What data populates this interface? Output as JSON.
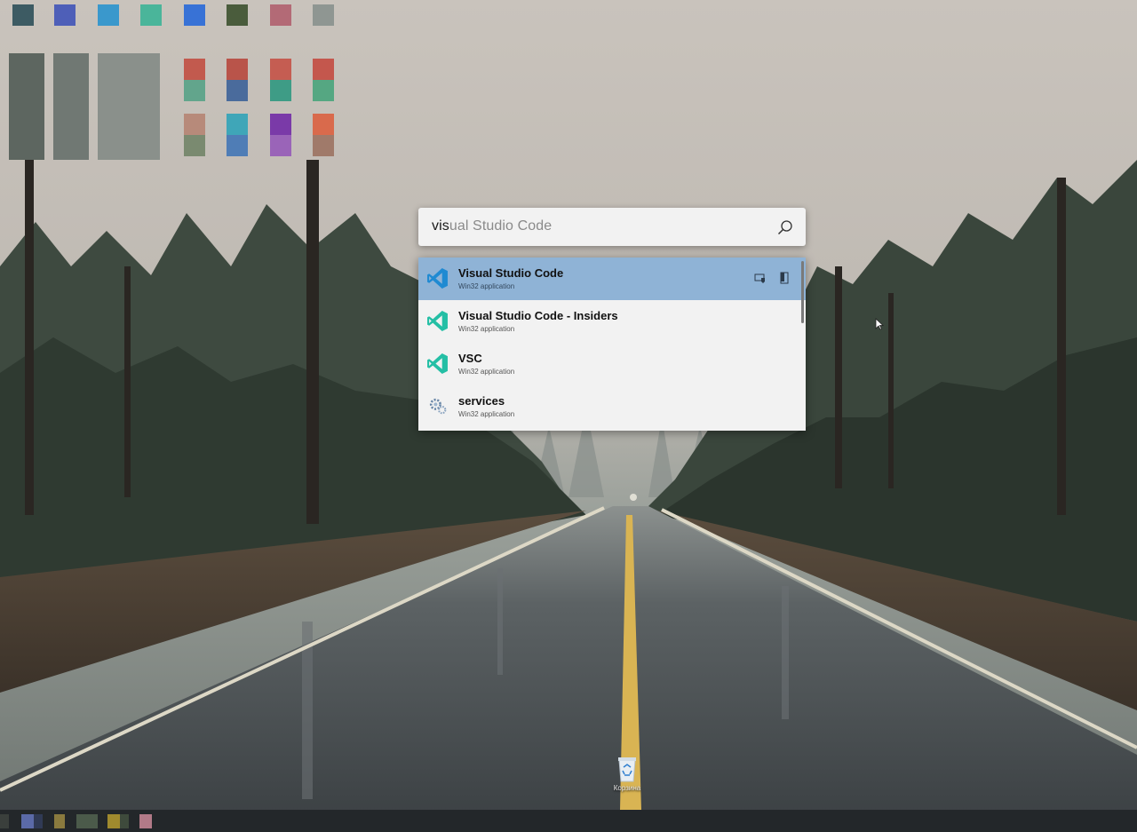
{
  "launcher": {
    "query_typed": "vis",
    "query_autocomplete": "ual Studio Code",
    "search_icon": "search-icon"
  },
  "results": [
    {
      "title": "Visual Studio Code",
      "subtitle": "Win32 application",
      "icon": "vscode-blue-icon",
      "selected": true
    },
    {
      "title": "Visual Studio Code - Insiders",
      "subtitle": "Win32 application",
      "icon": "vscode-insiders-icon",
      "selected": false
    },
    {
      "title": "VSC",
      "subtitle": "Win32 application",
      "icon": "vscode-insiders-icon",
      "selected": false
    },
    {
      "title": "services",
      "subtitle": "Win32 application",
      "icon": "services-gear-icon",
      "selected": false
    }
  ],
  "context_actions": [
    {
      "icon": "run-as-admin-icon"
    },
    {
      "icon": "open-containing-folder-icon"
    }
  ],
  "desktop": {
    "recycle_bin_label": "Корзина"
  },
  "colors": {
    "selected_row": "#8fb3d6",
    "panel_bg": "#f2f2f2",
    "vscode_blue": "#1f8ad2",
    "vscode_insiders": "#24bfa5",
    "taskbar": "#23272a"
  }
}
